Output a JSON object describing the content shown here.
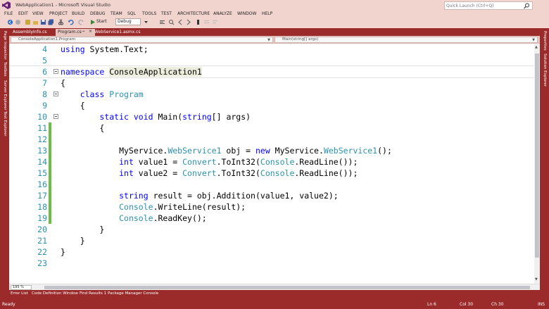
{
  "window": {
    "title": "WebApplication1 - Microsoft Visual Studio",
    "quick_launch_placeholder": "Quick Launch (Ctrl+Q)"
  },
  "menu": [
    "FILE",
    "EDIT",
    "VIEW",
    "PROJECT",
    "BUILD",
    "DEBUG",
    "TEAM",
    "SQL",
    "TOOLS",
    "TEST",
    "ARCHITECTURE",
    "ANALYZE",
    "WINDOW",
    "HELP"
  ],
  "toolbar": {
    "start_label": "Start",
    "config_value": "Debug"
  },
  "left_panels": [
    "Page Inspector",
    "Toolbox",
    "Server Explorer",
    "Test Explorer"
  ],
  "right_panels": [
    "Properties",
    "Solution Explorer"
  ],
  "doc_tabs": [
    {
      "label": "AssemblyInfo.cs",
      "active": false
    },
    {
      "label": "Program.cs",
      "active": true
    },
    {
      "label": "WebService1.asmx.cs",
      "active": false
    }
  ],
  "navbar": {
    "type_value": "ConsoleApplication1.Program",
    "member_value": "Main(string[] args)"
  },
  "code_lines": [
    {
      "num": "4",
      "text": "using System.Text;"
    },
    {
      "num": "5",
      "text": ""
    },
    {
      "num": "6",
      "text": "namespace ConsoleApplication1"
    },
    {
      "num": "7",
      "text": "{"
    },
    {
      "num": "8",
      "text": "    class Program"
    },
    {
      "num": "9",
      "text": "    {"
    },
    {
      "num": "10",
      "text": "        static void Main(string[] args)"
    },
    {
      "num": "11",
      "text": "        {"
    },
    {
      "num": "12",
      "text": ""
    },
    {
      "num": "13",
      "text": "            MyService.WebService1 obj = new MyService.WebService1();"
    },
    {
      "num": "14",
      "text": "            int value1 = Convert.ToInt32(Console.ReadLine());"
    },
    {
      "num": "15",
      "text": "            int value2 = Convert.ToInt32(Console.ReadLine());"
    },
    {
      "num": "16",
      "text": ""
    },
    {
      "num": "17",
      "text": "            string result = obj.Addition(value1, value2);"
    },
    {
      "num": "18",
      "text": "            Console.WriteLine(result);"
    },
    {
      "num": "19",
      "text": "            Console.ReadKey();"
    },
    {
      "num": "20",
      "text": "        }"
    },
    {
      "num": "21",
      "text": "    }"
    },
    {
      "num": "22",
      "text": "}"
    },
    {
      "num": "23",
      "text": ""
    }
  ],
  "zoom_value": "195 %",
  "tool_tabs": [
    "Error List",
    "Code Definition Window",
    "Find Results 1",
    "Package Manager Console"
  ],
  "status": {
    "state": "Ready",
    "line": "Ln 6",
    "col": "Col 30",
    "ch": "Ch 30",
    "mode": "INS"
  },
  "colors": {
    "accent": "#9b2a2a",
    "chrome": "#f2d4ce",
    "keyword": "#0000ff",
    "type": "#2b91af",
    "changed_margin": "#6cbd45"
  }
}
